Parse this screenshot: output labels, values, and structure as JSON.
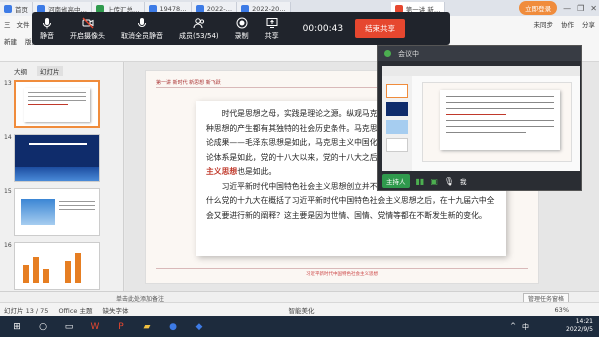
{
  "tabbar": {
    "tabs": [
      {
        "label": "首页",
        "icon_color": "#3d7be6"
      },
      {
        "label": "河南省高中…",
        "icon_color": "#3d7be6"
      },
      {
        "label": "上传汇总…",
        "icon_color": "#2f9a4d"
      },
      {
        "label": "19478…",
        "icon_color": "#3d7be6"
      },
      {
        "label": "2022-…",
        "icon_color": "#3d7be6"
      },
      {
        "label": "2022-20…",
        "icon_color": "#3d7be6"
      },
      {
        "label": "第一讲 新…",
        "icon_color": "#e6472f"
      }
    ],
    "login_label": "立即登录"
  },
  "meeting_bar": {
    "mute": "静音",
    "camera": "开启摄像头",
    "unmute_all": "取消全员静音",
    "members": "成员(53/54)",
    "record": "录制",
    "share": "共享",
    "timer": "00:00:43",
    "end_share": "结束共享"
  },
  "ribbon": {
    "menu": [
      "三",
      "文件",
      "开始",
      "插入",
      "设计",
      "切换",
      "动画",
      "幻灯片放映",
      "审阅",
      "视图"
    ],
    "tools": [
      "新建",
      "版式",
      "重置",
      "Aa",
      "剪贴板"
    ],
    "right": [
      "未同步",
      "协作",
      "分享"
    ]
  },
  "left_panel": {
    "tabs": [
      "大纲",
      "幻灯片"
    ],
    "slides": [
      {
        "num": "13"
      },
      {
        "num": "14"
      },
      {
        "num": "15"
      },
      {
        "num": "16"
      }
    ],
    "add": "+"
  },
  "slide": {
    "header": "第一讲  新时代  新思想  新飞跃",
    "para1": "时代是思想之母，实践是理论之源。纵观马克思主义发展史，不难发现，任何一种思想的产生都有其独特的社会历史条件。马克思主义中国化第一次历史性飞跃的理论成果——毛泽东思想是如此，马克思主义中国化新的飞跃——中国特色社会主义理论体系是如此，党的十八大以来，党的十八大之后创立的",
    "para1_red": "习近平新时代中国特色社会主义思想",
    "para1_end": "也是如此。",
    "para2": "习近平新时代中国特色社会主义思想创立并不断发展的社会历史条件有哪些？为什么党的十九大在概括了习近平新时代中国特色社会主义思想之后，在十九届六中全会又要进行新的阐释？这主要是因为世情、国情、党情等都在不断发生新的变化。",
    "footer": "习近平新时代中国特色社会主义思想"
  },
  "notes": {
    "hint": "单击此处添加备注",
    "task_pane": "管理任务窗格"
  },
  "statusbar": {
    "slide_count": "幻灯片 13 / 75",
    "theme": "Office 主题",
    "font_missing": "缺失字体",
    "smart_beautify": "智能美化",
    "zoom": "63%"
  },
  "meeting_window": {
    "title": "会议中",
    "host": "主持人",
    "me": "我"
  },
  "taskbar": {
    "time": "14:21",
    "date": "2022/9/5",
    "lang": "中"
  }
}
